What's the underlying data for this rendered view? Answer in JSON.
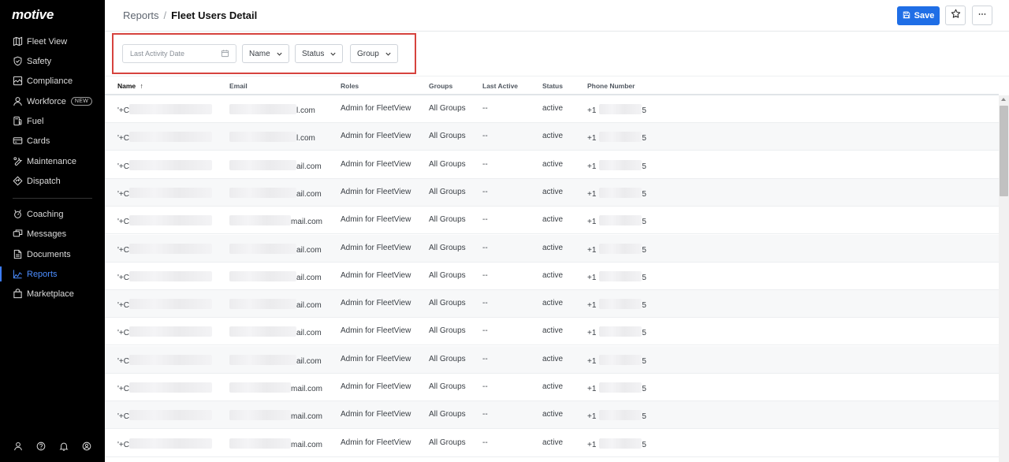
{
  "app": {
    "logo": "motive"
  },
  "sidebar": {
    "items": [
      {
        "label": "Fleet View",
        "icon": "map-icon"
      },
      {
        "label": "Safety",
        "icon": "shield-icon"
      },
      {
        "label": "Compliance",
        "icon": "compliance-icon"
      },
      {
        "label": "Workforce",
        "icon": "person-icon",
        "badge": "NEW"
      },
      {
        "label": "Fuel",
        "icon": "fuel-icon"
      },
      {
        "label": "Cards",
        "icon": "card-icon"
      },
      {
        "label": "Maintenance",
        "icon": "wrench-icon"
      },
      {
        "label": "Dispatch",
        "icon": "dispatch-icon"
      },
      {
        "label": "Coaching",
        "icon": "coaching-icon"
      },
      {
        "label": "Messages",
        "icon": "messages-icon"
      },
      {
        "label": "Documents",
        "icon": "document-icon"
      },
      {
        "label": "Reports",
        "icon": "reports-icon",
        "active": true
      },
      {
        "label": "Marketplace",
        "icon": "marketplace-icon"
      }
    ],
    "footer_icons": [
      "user-icon",
      "help-icon",
      "bell-icon",
      "account-icon"
    ]
  },
  "header": {
    "breadcrumb_parent": "Reports",
    "breadcrumb_separator": "/",
    "title": "Fleet Users Detail",
    "save_label": "Save",
    "favorite_icon": "star-icon",
    "more_icon": "more-icon"
  },
  "filters": {
    "date_placeholder": "Last Activity Date",
    "name_label": "Name",
    "status_label": "Status",
    "group_label": "Group"
  },
  "table": {
    "columns": [
      "Name",
      "Email",
      "Roles",
      "Groups",
      "Last Active",
      "Status",
      "Phone Number"
    ],
    "sort_indicator": "↑",
    "rows": [
      {
        "name": "'+C",
        "email": "l.com",
        "role": "Admin for FleetView",
        "groups": "All Groups",
        "last_active": "--",
        "status": "active",
        "phone_prefix": "+1",
        "phone_suffix": "5"
      },
      {
        "name": "'+C",
        "email": "l.com",
        "role": "Admin for FleetView",
        "groups": "All Groups",
        "last_active": "--",
        "status": "active",
        "phone_prefix": "+1",
        "phone_suffix": "5"
      },
      {
        "name": "'+C",
        "email": "ail.com",
        "role": "Admin for FleetView",
        "groups": "All Groups",
        "last_active": "--",
        "status": "active",
        "phone_prefix": "+1",
        "phone_suffix": "5"
      },
      {
        "name": "'+C",
        "email": "ail.com",
        "role": "Admin for FleetView",
        "groups": "All Groups",
        "last_active": "--",
        "status": "active",
        "phone_prefix": "+1",
        "phone_suffix": "5"
      },
      {
        "name": "'+C",
        "email": "mail.com",
        "role": "Admin for FleetView",
        "groups": "All Groups",
        "last_active": "--",
        "status": "active",
        "phone_prefix": "+1",
        "phone_suffix": "5"
      },
      {
        "name": "'+C",
        "email": "ail.com",
        "role": "Admin for FleetView",
        "groups": "All Groups",
        "last_active": "--",
        "status": "active",
        "phone_prefix": "+1",
        "phone_suffix": "5"
      },
      {
        "name": "'+C",
        "email": "ail.com",
        "role": "Admin for FleetView",
        "groups": "All Groups",
        "last_active": "--",
        "status": "active",
        "phone_prefix": "+1",
        "phone_suffix": "5"
      },
      {
        "name": "'+C",
        "email": "ail.com",
        "role": "Admin for FleetView",
        "groups": "All Groups",
        "last_active": "--",
        "status": "active",
        "phone_prefix": "+1",
        "phone_suffix": "5"
      },
      {
        "name": "'+C",
        "email": "ail.com",
        "role": "Admin for FleetView",
        "groups": "All Groups",
        "last_active": "--",
        "status": "active",
        "phone_prefix": "+1",
        "phone_suffix": "5"
      },
      {
        "name": "'+C",
        "email": "ail.com",
        "role": "Admin for FleetView",
        "groups": "All Groups",
        "last_active": "--",
        "status": "active",
        "phone_prefix": "+1",
        "phone_suffix": "5"
      },
      {
        "name": "'+C",
        "email": "mail.com",
        "role": "Admin for FleetView",
        "groups": "All Groups",
        "last_active": "--",
        "status": "active",
        "phone_prefix": "+1",
        "phone_suffix": "5"
      },
      {
        "name": "'+C",
        "email": "mail.com",
        "role": "Admin for FleetView",
        "groups": "All Groups",
        "last_active": "--",
        "status": "active",
        "phone_prefix": "+1",
        "phone_suffix": "5"
      },
      {
        "name": "'+C",
        "email": "mail.com",
        "role": "Admin for FleetView",
        "groups": "All Groups",
        "last_active": "--",
        "status": "active",
        "phone_prefix": "+1",
        "phone_suffix": "5"
      }
    ]
  },
  "colors": {
    "sidebar_bg": "#000000",
    "accent": "#1f6ee6",
    "active_nav": "#4b8dff",
    "highlight_border": "#d6433e"
  }
}
